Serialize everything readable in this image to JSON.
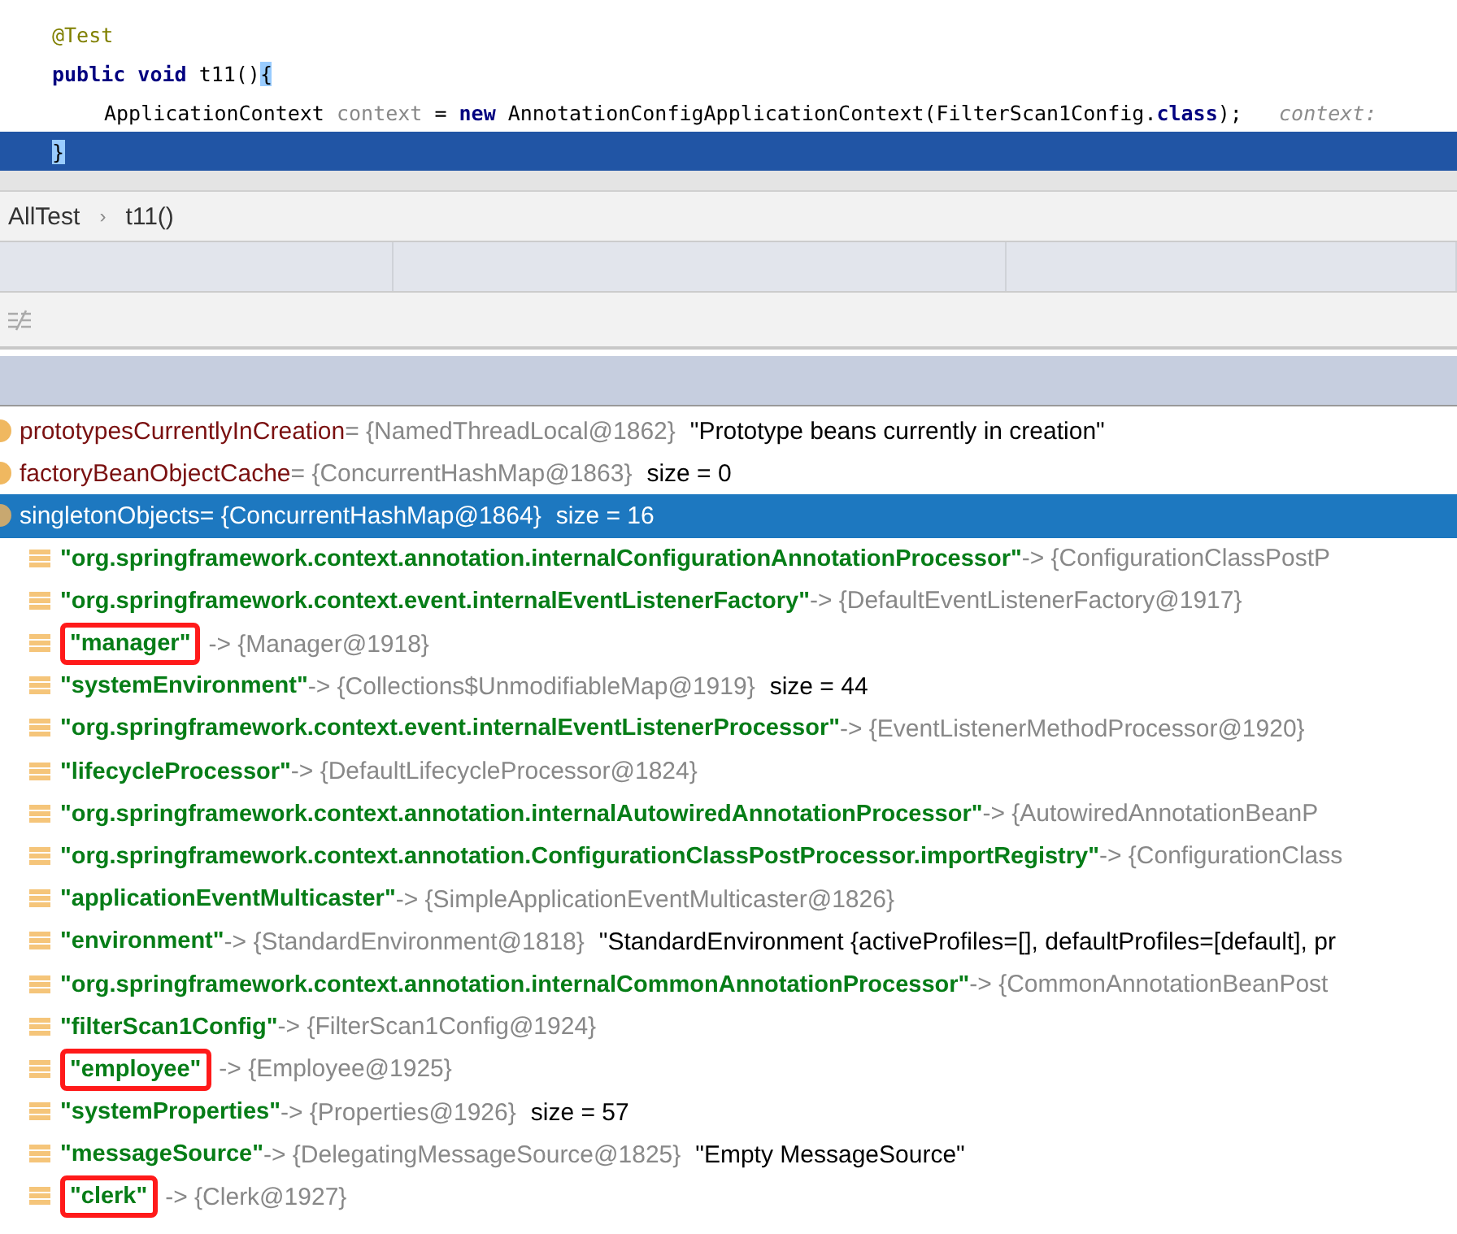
{
  "code": {
    "lines": [
      {
        "selected": false,
        "kind": "outer",
        "tokens": [
          {
            "text": "@Test",
            "kind": "annotation"
          }
        ]
      },
      {
        "selected": false,
        "kind": "outer",
        "tokens": [
          {
            "text": "public",
            "kind": "keyword"
          },
          {
            "text": " void",
            "kind": "keyword"
          },
          {
            "text": " t11()",
            "kind": "plain"
          },
          {
            "text": "{",
            "kind": "brace"
          }
        ]
      },
      {
        "selected": false,
        "kind": "body",
        "tokens": [
          {
            "text": "ApplicationContext ",
            "kind": "plain"
          },
          {
            "text": "context",
            "kind": "var"
          },
          {
            "text": " = ",
            "kind": "plain"
          },
          {
            "text": "new",
            "kind": "keyword"
          },
          {
            "text": " AnnotationConfigApplicationContext(FilterScan1Config.",
            "kind": "plain"
          },
          {
            "text": "class",
            "kind": "keyword"
          },
          {
            "text": ");",
            "kind": "plain"
          },
          {
            "text": "   context:",
            "kind": "hint"
          }
        ]
      },
      {
        "selected": true,
        "kind": "outer",
        "tokens": [
          {
            "text": "}",
            "kind": "brace"
          }
        ]
      }
    ]
  },
  "breadcrumb": {
    "items": [
      "AllTest",
      "t11()"
    ],
    "separator": "›"
  },
  "variables": [
    {
      "kind": "field",
      "selected": false,
      "name": "prototypesCurrentlyInCreation",
      "value": " = {NamedThreadLocal@1862}",
      "extra": "\"Prototype beans currently in creation\""
    },
    {
      "kind": "field",
      "selected": false,
      "name": "factoryBeanObjectCache",
      "value": " = {ConcurrentHashMap@1863}",
      "extra": "size = 0"
    },
    {
      "kind": "field",
      "selected": true,
      "name": "singletonObjects",
      "value": " = {ConcurrentHashMap@1864}",
      "extra": "size = 16"
    },
    {
      "kind": "entry",
      "highlighted": false,
      "name": "\"org.springframework.context.annotation.internalConfigurationAnnotationProcessor\"",
      "value": " -> {ConfigurationClassPostP"
    },
    {
      "kind": "entry",
      "highlighted": false,
      "name": "\"org.springframework.context.event.internalEventListenerFactory\"",
      "value": " -> {DefaultEventListenerFactory@1917}"
    },
    {
      "kind": "entry",
      "highlighted": true,
      "name": "\"manager\"",
      "value": " -> {Manager@1918}"
    },
    {
      "kind": "entry",
      "highlighted": false,
      "name": "\"systemEnvironment\"",
      "value": " -> {Collections$UnmodifiableMap@1919}",
      "extra": "size = 44"
    },
    {
      "kind": "entry",
      "highlighted": false,
      "name": "\"org.springframework.context.event.internalEventListenerProcessor\"",
      "value": " -> {EventListenerMethodProcessor@1920}"
    },
    {
      "kind": "entry",
      "highlighted": false,
      "name": "\"lifecycleProcessor\"",
      "value": " -> {DefaultLifecycleProcessor@1824}"
    },
    {
      "kind": "entry",
      "highlighted": false,
      "name": "\"org.springframework.context.annotation.internalAutowiredAnnotationProcessor\"",
      "value": " -> {AutowiredAnnotationBeanP"
    },
    {
      "kind": "entry",
      "highlighted": false,
      "name": "\"org.springframework.context.annotation.ConfigurationClassPostProcessor.importRegistry\"",
      "value": " -> {ConfigurationClass"
    },
    {
      "kind": "entry",
      "highlighted": false,
      "name": "\"applicationEventMulticaster\"",
      "value": " -> {SimpleApplicationEventMulticaster@1826}"
    },
    {
      "kind": "entry",
      "highlighted": false,
      "name": "\"environment\"",
      "value": " -> {StandardEnvironment@1818}",
      "extra": "\"StandardEnvironment {activeProfiles=[], defaultProfiles=[default], pr"
    },
    {
      "kind": "entry",
      "highlighted": false,
      "name": "\"org.springframework.context.annotation.internalCommonAnnotationProcessor\"",
      "value": " -> {CommonAnnotationBeanPost"
    },
    {
      "kind": "entry",
      "highlighted": false,
      "name": "\"filterScan1Config\"",
      "value": " -> {FilterScan1Config@1924}"
    },
    {
      "kind": "entry",
      "highlighted": true,
      "name": "\"employee\"",
      "value": " -> {Employee@1925}"
    },
    {
      "kind": "entry",
      "highlighted": false,
      "name": "\"systemProperties\"",
      "value": " -> {Properties@1926}",
      "extra": "size = 57"
    },
    {
      "kind": "entry",
      "highlighted": false,
      "name": "\"messageSource\"",
      "value": " -> {DelegatingMessageSource@1825}",
      "extra": "\"Empty MessageSource\""
    },
    {
      "kind": "entry",
      "highlighted": true,
      "name": "\"clerk\"",
      "value": " -> {Clerk@1927}"
    }
  ]
}
